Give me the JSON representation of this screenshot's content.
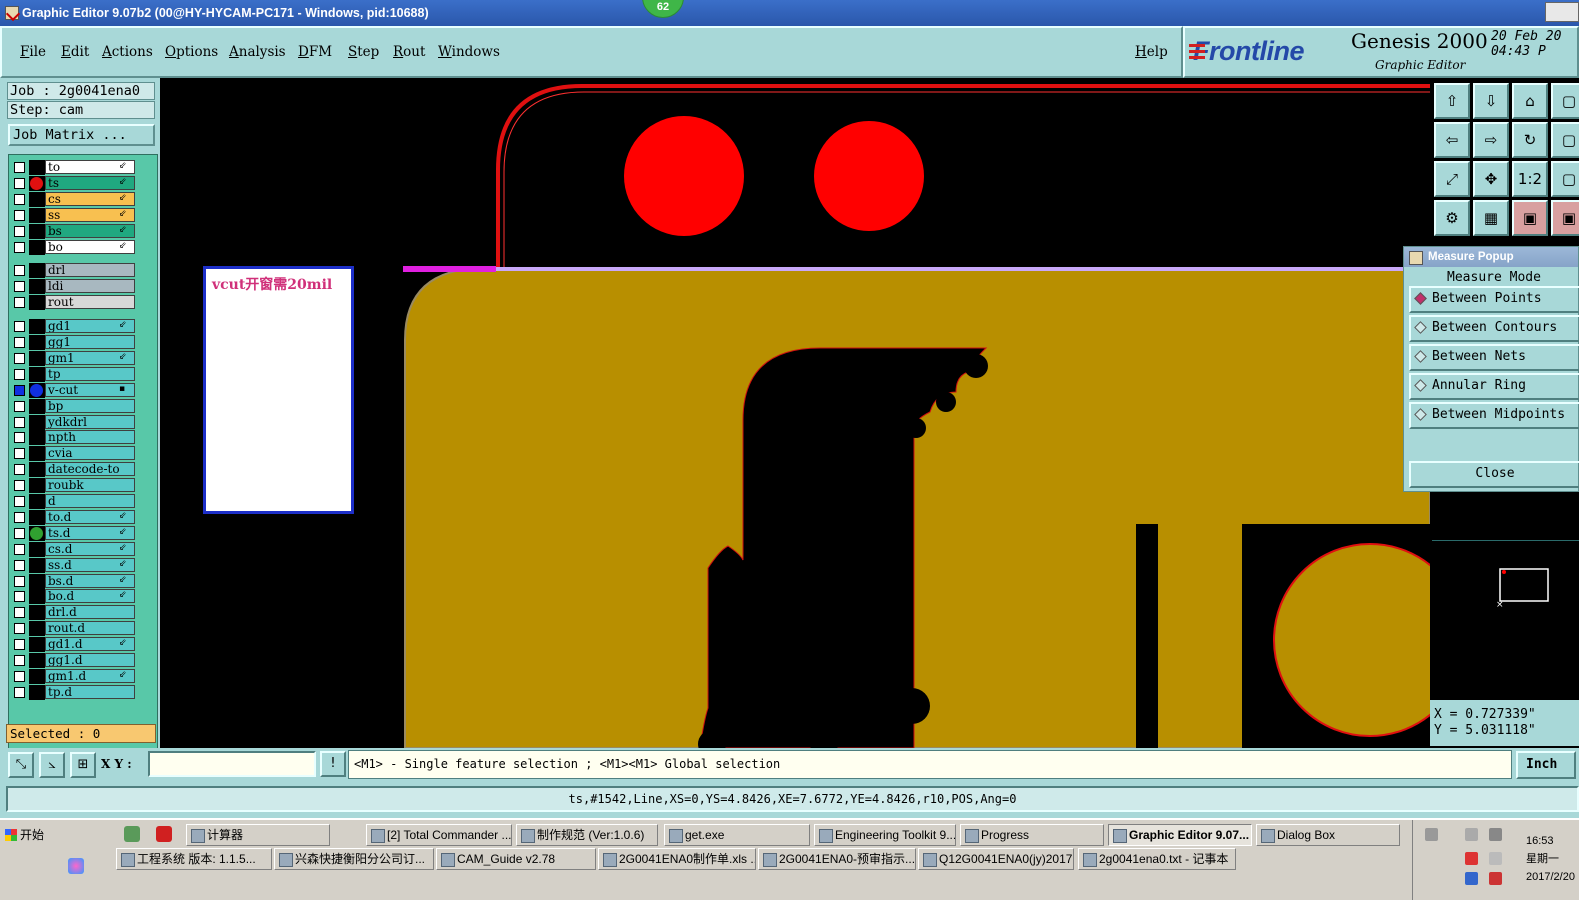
{
  "window": {
    "title": "Graphic Editor 9.07b2 (00@HY-HYCAM-PC171 - Windows, pid:10688)",
    "badge": "62"
  },
  "menu": {
    "items": [
      "File",
      "Edit",
      "Actions",
      "Options",
      "Analysis",
      "DFM",
      "Step",
      "Rout",
      "Windows"
    ],
    "help": "Help"
  },
  "brand": {
    "logo": "Frontline",
    "product": "Genesis 2000",
    "subtitle": "Graphic Editor",
    "date_line1": "20 Feb 20",
    "date_line2": "04:43 P"
  },
  "job": {
    "job_label": "Job : 2g0041ena0",
    "step_label": "Step: cam",
    "matrix_button": "Job Matrix ..."
  },
  "layers": [
    {
      "name": "to",
      "color": "#ffffff",
      "dot": "",
      "mark": "⇙"
    },
    {
      "name": "ts",
      "color": "#20a880",
      "dot": "#e01010",
      "mark": "⇙"
    },
    {
      "name": "cs",
      "color": "#f8c050",
      "dot": "",
      "mark": "⇙"
    },
    {
      "name": "ss",
      "color": "#f8c050",
      "dot": "",
      "mark": "⇙"
    },
    {
      "name": "bs",
      "color": "#20a880",
      "dot": "",
      "mark": "⇙"
    },
    {
      "name": "bo",
      "color": "#ffffff",
      "dot": "",
      "mark": "⇙"
    },
    {
      "name": "drl",
      "color": "#a8b8c0",
      "dot": "",
      "mark": ""
    },
    {
      "name": "ldi",
      "color": "#a8b8c0",
      "dot": "",
      "mark": ""
    },
    {
      "name": "rout",
      "color": "#d8d8d8",
      "dot": "",
      "mark": ""
    },
    {
      "name": "gd1",
      "color": "#58c8c8",
      "dot": "",
      "mark": "⇙"
    },
    {
      "name": "gg1",
      "color": "#58c8c8",
      "dot": "",
      "mark": ""
    },
    {
      "name": "gm1",
      "color": "#58c8c8",
      "dot": "",
      "mark": "⇙"
    },
    {
      "name": "tp",
      "color": "#58c8c8",
      "dot": "",
      "mark": ""
    },
    {
      "name": "v-cut",
      "color": "#58c8c8",
      "dot": "#1030e0",
      "mark": "▪"
    },
    {
      "name": "bp",
      "color": "#58c8c8",
      "dot": "",
      "mark": ""
    },
    {
      "name": "ydkdrl",
      "color": "#58c8c8",
      "dot": "",
      "mark": ""
    },
    {
      "name": "npth",
      "color": "#58c8c8",
      "dot": "",
      "mark": ""
    },
    {
      "name": "cvia",
      "color": "#58c8c8",
      "dot": "",
      "mark": ""
    },
    {
      "name": "datecode-to",
      "color": "#58c8c8",
      "dot": "",
      "mark": ""
    },
    {
      "name": "roubk",
      "color": "#58c8c8",
      "dot": "",
      "mark": ""
    },
    {
      "name": "d",
      "color": "#58c8c8",
      "dot": "",
      "mark": ""
    },
    {
      "name": "to.d",
      "color": "#58c8c8",
      "dot": "",
      "mark": "⇙"
    },
    {
      "name": "ts.d",
      "color": "#58c8c8",
      "dot": "#30a030",
      "mark": "⇙"
    },
    {
      "name": "cs.d",
      "color": "#58c8c8",
      "dot": "",
      "mark": "⇙"
    },
    {
      "name": "ss.d",
      "color": "#58c8c8",
      "dot": "",
      "mark": "⇙"
    },
    {
      "name": "bs.d",
      "color": "#58c8c8",
      "dot": "",
      "mark": "⇙"
    },
    {
      "name": "bo.d",
      "color": "#58c8c8",
      "dot": "",
      "mark": "⇙"
    },
    {
      "name": "drl.d",
      "color": "#58c8c8",
      "dot": "",
      "mark": ""
    },
    {
      "name": "rout.d",
      "color": "#58c8c8",
      "dot": "",
      "mark": ""
    },
    {
      "name": "gd1.d",
      "color": "#58c8c8",
      "dot": "",
      "mark": "⇙"
    },
    {
      "name": "gg1.d",
      "color": "#58c8c8",
      "dot": "",
      "mark": ""
    },
    {
      "name": "gm1.d",
      "color": "#58c8c8",
      "dot": "",
      "mark": "⇙"
    },
    {
      "name": "tp.d",
      "color": "#58c8c8",
      "dot": "",
      "mark": ""
    }
  ],
  "selected": "Selected : 0",
  "canvas": {
    "note": "vcut开窗需20mil",
    "colors": {
      "copper": "#b88f00",
      "pad": "#ff0000",
      "outline": "#e01010",
      "vcut": "#c8a8f8",
      "magenta": "#e020e0"
    }
  },
  "measure": {
    "title": "Measure Popup",
    "mode_label": "Measure Mode",
    "options": [
      "Between Points",
      "Between Contours",
      "Between Nets",
      "Annular Ring",
      "Between Midpoints"
    ],
    "selected": "Between Points",
    "close": "Close"
  },
  "coords": {
    "x": "X = 0.727339\"",
    "y": "Y = 5.031118\""
  },
  "command": {
    "xy_label": "X Y :",
    "xy_value": "",
    "hint": "<M1> - Single feature selection ; <M1><M1> Global selection",
    "unit": "Inch"
  },
  "status": "ts,#1542,Line,XS=0,YS=4.8426,XE=7.6772,YE=4.8426,r10,POS,Ang=0",
  "taskbar": {
    "start": "开始",
    "row1": [
      "计算器",
      "[2] Total Commander ...",
      "制作规范 (Ver:1.0.6)",
      "get.exe",
      "Engineering Toolkit 9....",
      "Progress",
      "Graphic Editor 9.07...",
      "Dialog Box"
    ],
    "row2": [
      "工程系统  版本: 1.1.5...",
      "兴森快捷衡阳分公司订...",
      "CAM_Guide v2.78",
      "2G0041ENA0制作单.xls ...",
      "2G0041ENA0-预审指示....",
      "Q12G0041ENA0(jy)2017...",
      "2g0041ena0.txt - 记事本"
    ],
    "active": "Graphic Editor 9.07...",
    "clock_time": "16:53",
    "clock_day": "星期一",
    "clock_date": "2017/2/20"
  }
}
